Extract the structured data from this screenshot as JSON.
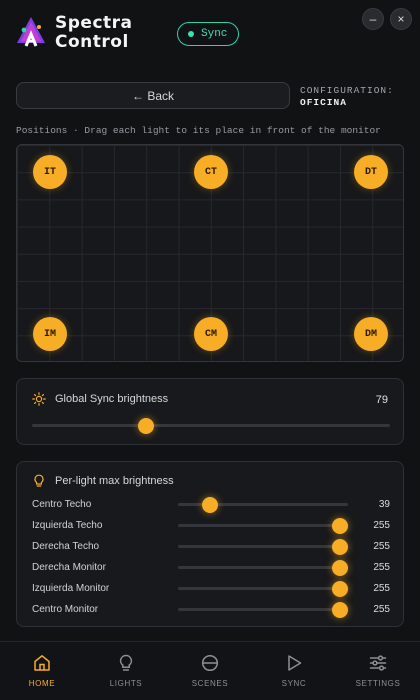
{
  "app": {
    "title_line1": "Spectra",
    "title_line2": "Control",
    "sync_badge": "Sync",
    "minimize_glyph": "–",
    "close_glyph": "×"
  },
  "toolbar": {
    "back_label": "← Back",
    "config_label": "CONFIGURATION:",
    "config_value": "OFICINA"
  },
  "positions": {
    "caption": "Positions · Drag each light to its place in front of the monitor",
    "lights": [
      {
        "id": "it",
        "label": "IT"
      },
      {
        "id": "ct",
        "label": "CT"
      },
      {
        "id": "dt",
        "label": "DT"
      },
      {
        "id": "im",
        "label": "IM"
      },
      {
        "id": "cm",
        "label": "CM"
      },
      {
        "id": "dm",
        "label": "DM"
      }
    ]
  },
  "global_brightness": {
    "title": "Global Sync brightness",
    "value": "79",
    "max": 255,
    "icon": "sun-icon"
  },
  "per_light": {
    "title": "Per-light max brightness",
    "icon": "lightbulb-icon",
    "max": 255,
    "rows": [
      {
        "name": "Centro Techo",
        "value": "39"
      },
      {
        "name": "Izquierda Techo",
        "value": "255"
      },
      {
        "name": "Derecha Techo",
        "value": "255"
      },
      {
        "name": "Derecha Monitor",
        "value": "255"
      },
      {
        "name": "Izquierda Monitor",
        "value": "255"
      },
      {
        "name": "Centro Monitor",
        "value": "255"
      }
    ]
  },
  "nav": {
    "items": [
      {
        "label": "HOME",
        "icon": "home-icon",
        "active": true
      },
      {
        "label": "LIGHTS",
        "icon": "lightbulb-icon",
        "active": false
      },
      {
        "label": "SCENES",
        "icon": "scenes-icon",
        "active": false
      },
      {
        "label": "SYNC",
        "icon": "play-icon",
        "active": false
      },
      {
        "label": "SETTINGS",
        "icon": "sliders-icon",
        "active": false
      }
    ]
  },
  "colors": {
    "accent": "#f7ad26",
    "sync": "#2fd3a6",
    "background": "#111214"
  }
}
